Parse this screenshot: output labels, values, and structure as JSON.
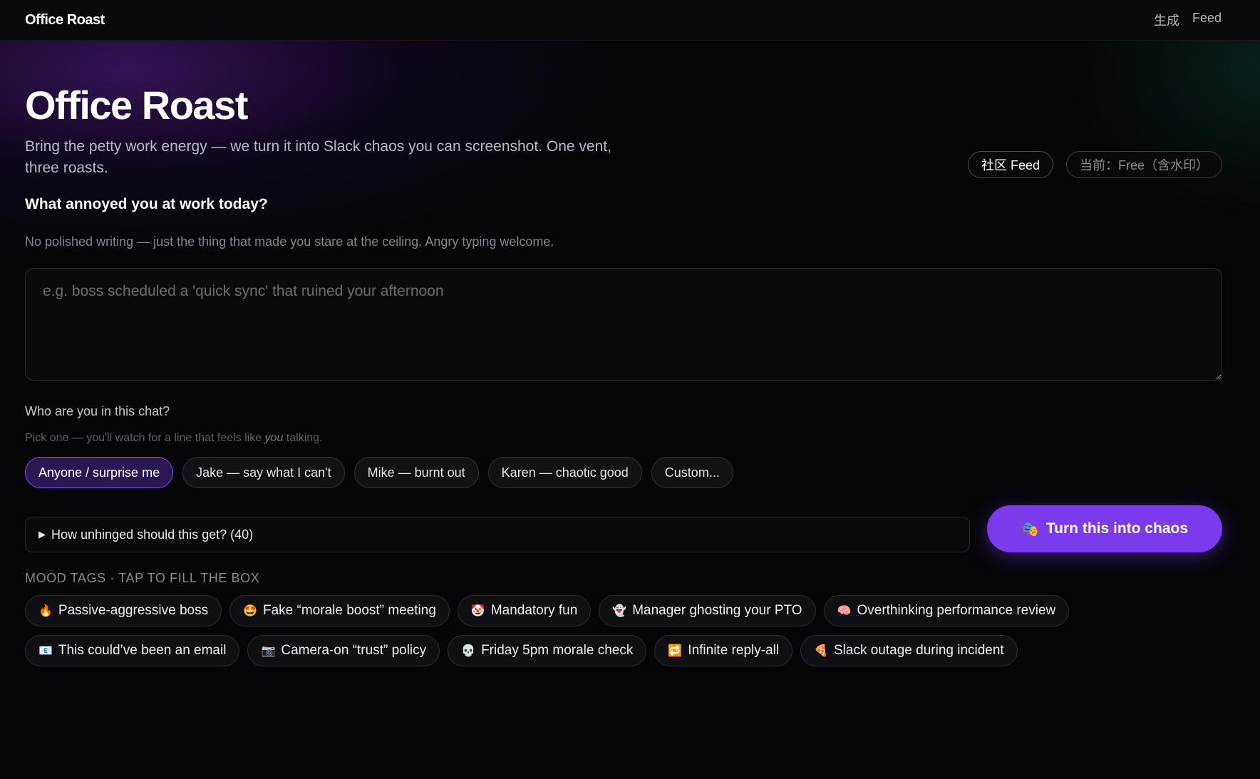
{
  "topbar": {
    "brand": "Office Roast",
    "nav": [
      "生成",
      "Feed"
    ]
  },
  "hero": {
    "title": "Office Roast",
    "subtitle": "Bring the petty work energy — we turn it into Slack chaos you can screenshot. One vent, three roasts.",
    "community_feed": "社区 Feed",
    "plan_status": "当前：Free（含水印）"
  },
  "form": {
    "question": "What annoyed you at work today?",
    "hint": "No polished writing — just the thing that made you stare at the ceiling. Angry typing welcome.",
    "placeholder": "e.g. boss scheduled a 'quick sync' that ruined your afternoon",
    "value": "",
    "who_label": "Who are you in this chat?",
    "who_hint_before": "Pick one — you'll watch for a line that feels like ",
    "who_hint_em": "you",
    "who_hint_after": " talking.",
    "personas": [
      {
        "label": "Anyone / surprise me",
        "selected": true
      },
      {
        "label": "Jake — say what I can't",
        "selected": false
      },
      {
        "label": "Mike — burnt out",
        "selected": false
      },
      {
        "label": "Karen — chaotic good",
        "selected": false
      },
      {
        "label": "Custom...",
        "selected": false
      }
    ],
    "unhinged_summary": "How unhinged should this get? (40)",
    "cta_label": "Turn this into chaos",
    "cta_icon": "🎭"
  },
  "mood": {
    "label": "MOOD TAGS · TAP TO FILL THE BOX",
    "row1": [
      {
        "emoji": "🔥",
        "label": "Passive-aggressive boss"
      },
      {
        "emoji": "🤩",
        "label": "Fake “morale boost” meeting"
      },
      {
        "emoji": "🤡",
        "label": "Mandatory fun"
      },
      {
        "emoji": "👻",
        "label": "Manager ghosting your PTO"
      },
      {
        "emoji": "🧠",
        "label": "Overthinking performance review"
      }
    ],
    "row2": [
      {
        "emoji": "📧",
        "label": "This could’ve been an email"
      },
      {
        "emoji": "📷",
        "label": "Camera-on “trust” policy"
      },
      {
        "emoji": "💀",
        "label": "Friday 5pm morale check"
      },
      {
        "emoji": "🔁",
        "label": "Infinite reply-all"
      },
      {
        "emoji": "🍕",
        "label": "Slack outage during incident"
      }
    ]
  },
  "colors": {
    "accent": "#7c3aed",
    "selected_bg": "#2a1854",
    "background": "#050507"
  }
}
